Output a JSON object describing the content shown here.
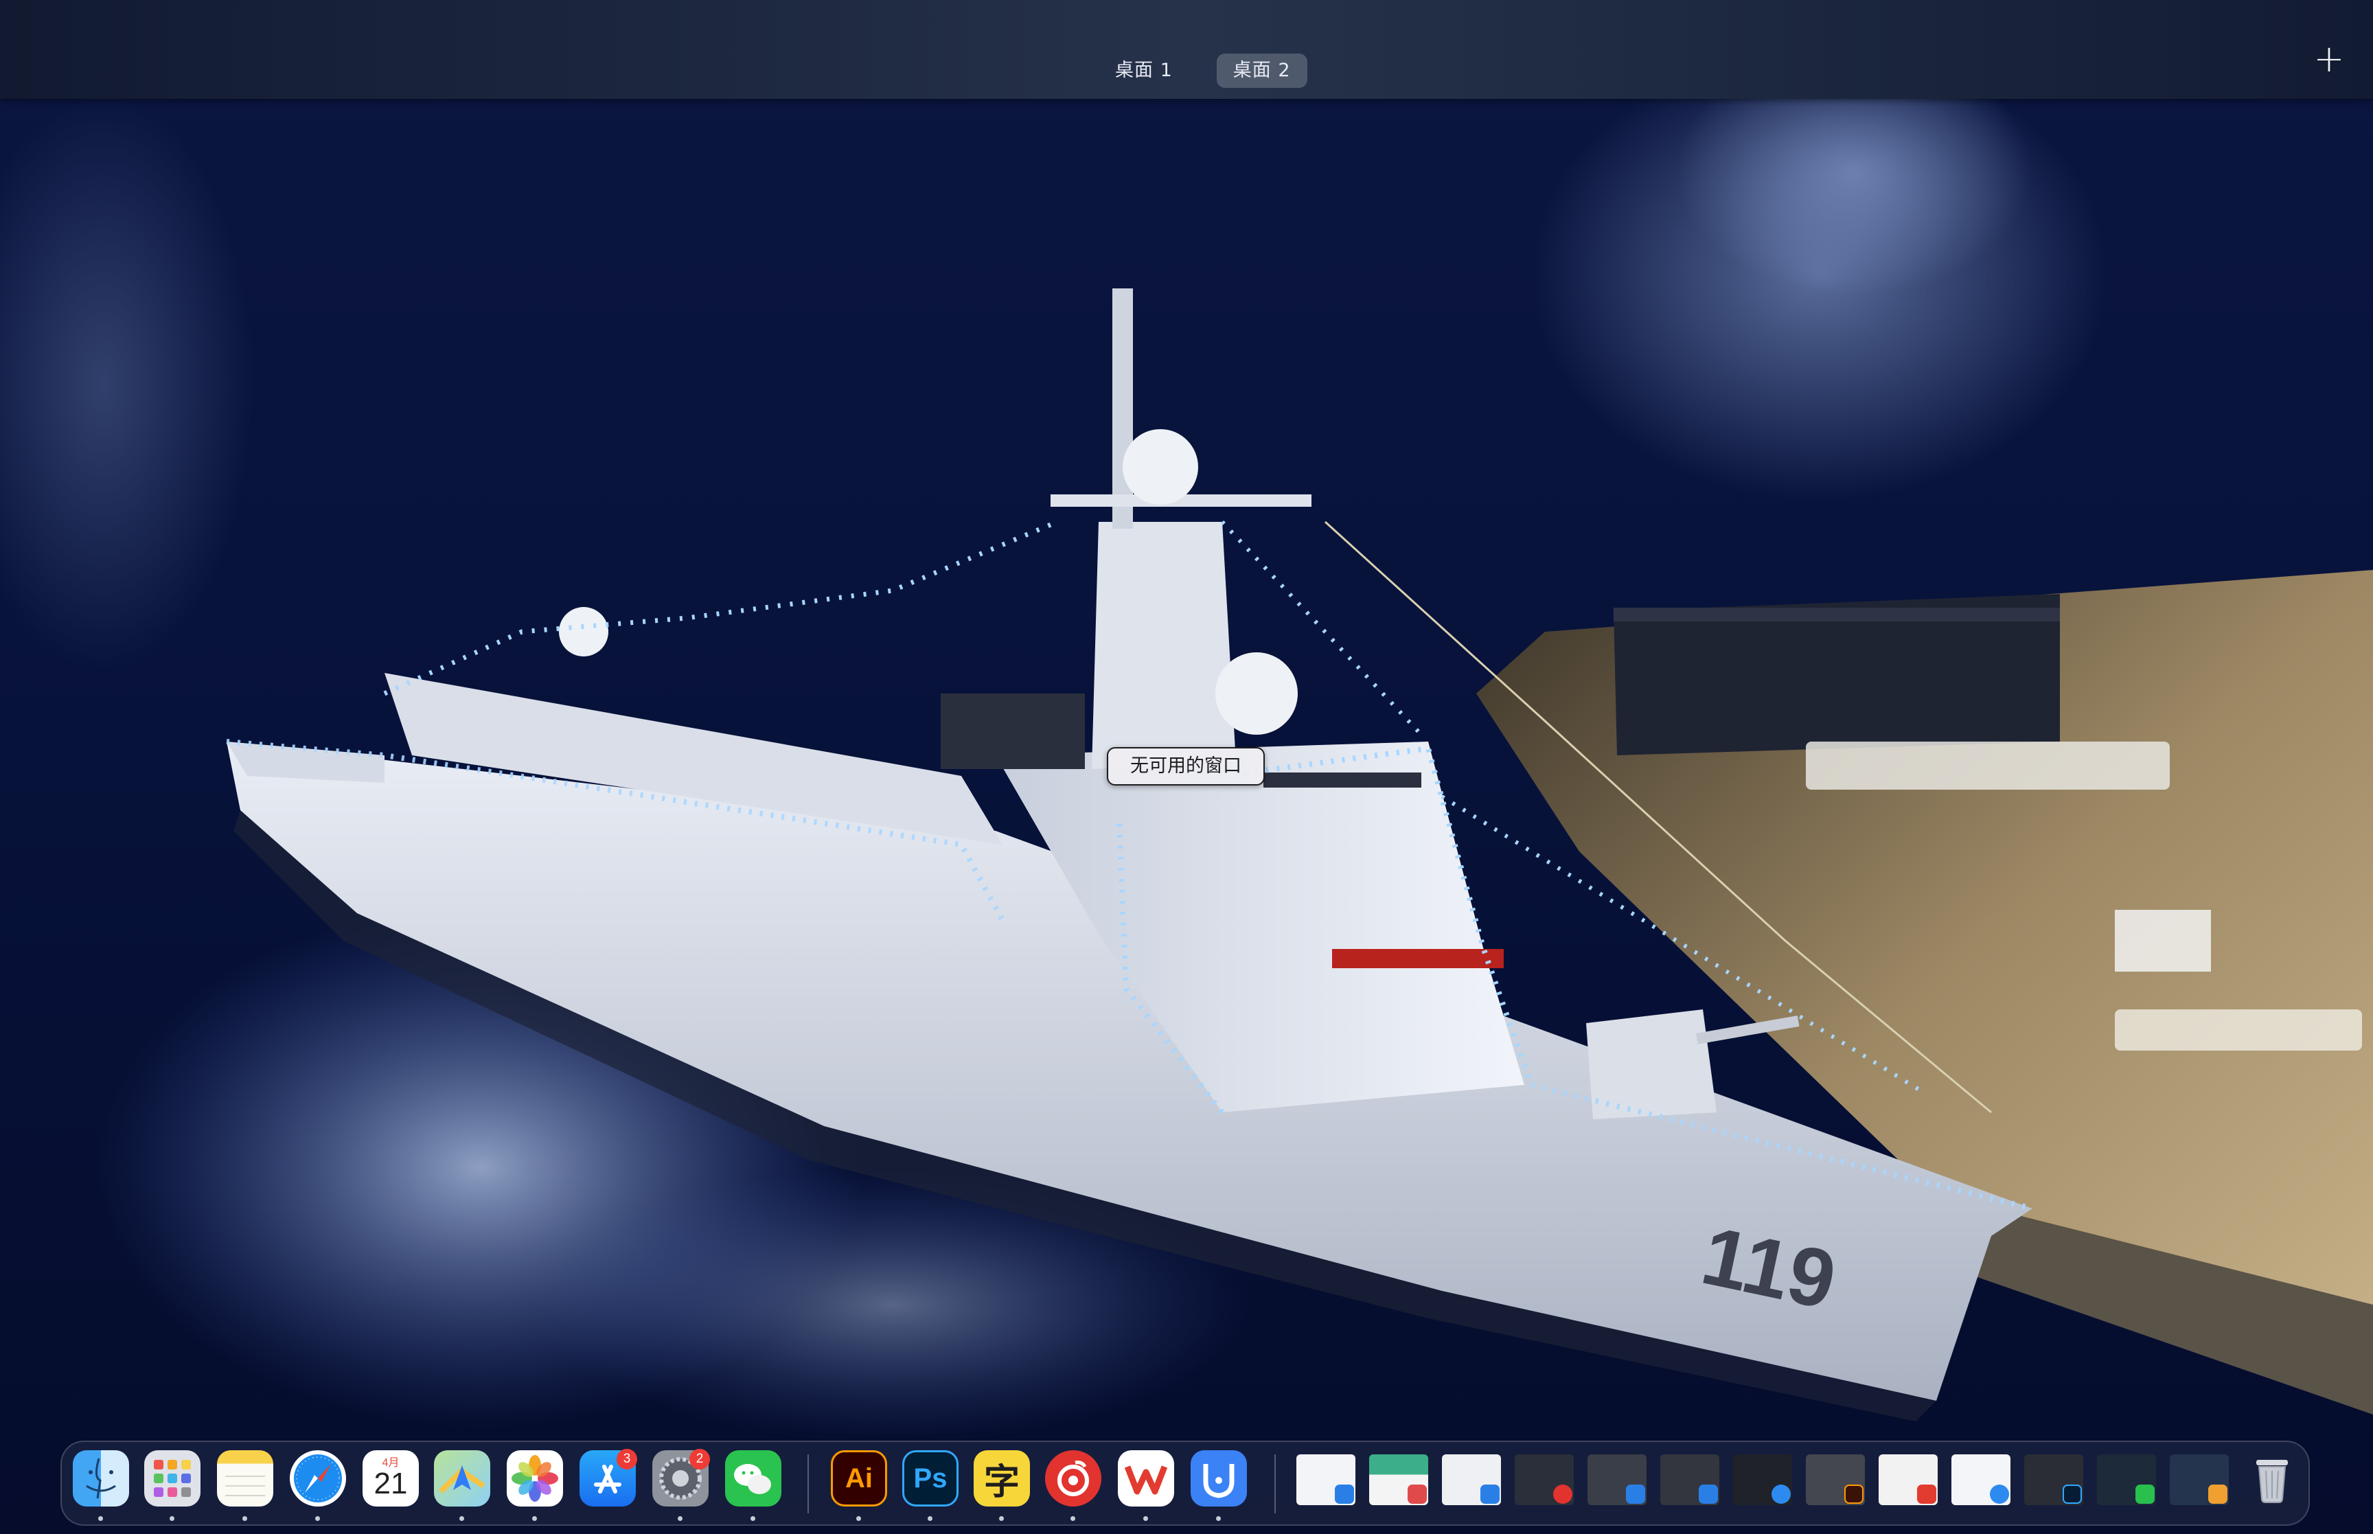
{
  "spaces": {
    "items": [
      {
        "label": "桌面 1",
        "active": false
      },
      {
        "label": "桌面 2",
        "active": true
      }
    ],
    "add_label": "+"
  },
  "tooltip": {
    "text": "无可用的窗口"
  },
  "wallpaper": {
    "hull_number": "119",
    "colors": {
      "sea": "#07123a",
      "sky_glow": "#1d2a5a",
      "ship": "#dfe4ee",
      "quay": "#b7a17d",
      "lights": "#9fd1ff"
    }
  },
  "dock": {
    "apps": [
      {
        "name": "finder",
        "icon": "finder-icon",
        "running": true
      },
      {
        "name": "launchpad",
        "icon": "launchpad-icon",
        "running": true
      },
      {
        "name": "notes",
        "icon": "notes-icon",
        "running": true
      },
      {
        "name": "safari",
        "icon": "safari-icon",
        "running": true
      },
      {
        "name": "calendar",
        "icon": "calendar-icon",
        "running": false,
        "month": "4月",
        "day": "21"
      },
      {
        "name": "maps",
        "icon": "maps-icon",
        "running": true
      },
      {
        "name": "photos",
        "icon": "photos-icon",
        "running": true
      },
      {
        "name": "app-store",
        "icon": "app-store-icon",
        "running": false,
        "badge": "3"
      },
      {
        "name": "system-settings",
        "icon": "gear-icon",
        "running": true,
        "badge": "2"
      },
      {
        "name": "wechat",
        "icon": "wechat-icon",
        "running": true
      },
      {
        "name": "illustrator",
        "icon": "illustrator-icon",
        "running": true,
        "label": "Ai"
      },
      {
        "name": "photoshop",
        "icon": "photoshop-icon",
        "running": true,
        "label": "Ps"
      },
      {
        "name": "subtitle-app",
        "icon": "zi-icon",
        "running": true,
        "label": "字"
      },
      {
        "name": "netease-music",
        "icon": "netease-music-icon",
        "running": true
      },
      {
        "name": "wps",
        "icon": "wps-icon",
        "running": true
      },
      {
        "name": "utility-app",
        "icon": "shield-app-icon",
        "running": true
      }
    ],
    "minimized_windows": [
      {
        "name": "window-finder",
        "app_icon": "finder-icon",
        "color": "#2a7fe6"
      },
      {
        "name": "window-notes-green",
        "app_icon": "notes-icon",
        "color": "#e04a4a"
      },
      {
        "name": "window-finder-2",
        "app_icon": "finder-icon",
        "color": "#2a7fe6"
      },
      {
        "name": "window-netease",
        "app_icon": "netease-music-icon",
        "color": "#e2332f"
      },
      {
        "name": "window-finder-3",
        "app_icon": "finder-icon",
        "color": "#2a7fe6"
      },
      {
        "name": "window-finder-4",
        "app_icon": "finder-icon",
        "color": "#2a7fe6"
      },
      {
        "name": "window-safari",
        "app_icon": "safari-icon",
        "color": "#2d8bf0"
      },
      {
        "name": "window-illustrator",
        "app_icon": "illustrator-icon",
        "color": "#3a1206"
      },
      {
        "name": "window-wps",
        "app_icon": "wps-icon",
        "color": "#e23b30"
      },
      {
        "name": "window-safari-2",
        "app_icon": "safari-icon",
        "color": "#2d8bf0"
      },
      {
        "name": "window-photoshop",
        "app_icon": "photoshop-icon",
        "color": "#061d35"
      },
      {
        "name": "window-wechat",
        "app_icon": "wechat-icon",
        "color": "#29c04d"
      },
      {
        "name": "window-photos",
        "app_icon": "photos-icon",
        "color": "#f0a030"
      }
    ],
    "trash": {
      "icon": "trash-icon"
    }
  }
}
